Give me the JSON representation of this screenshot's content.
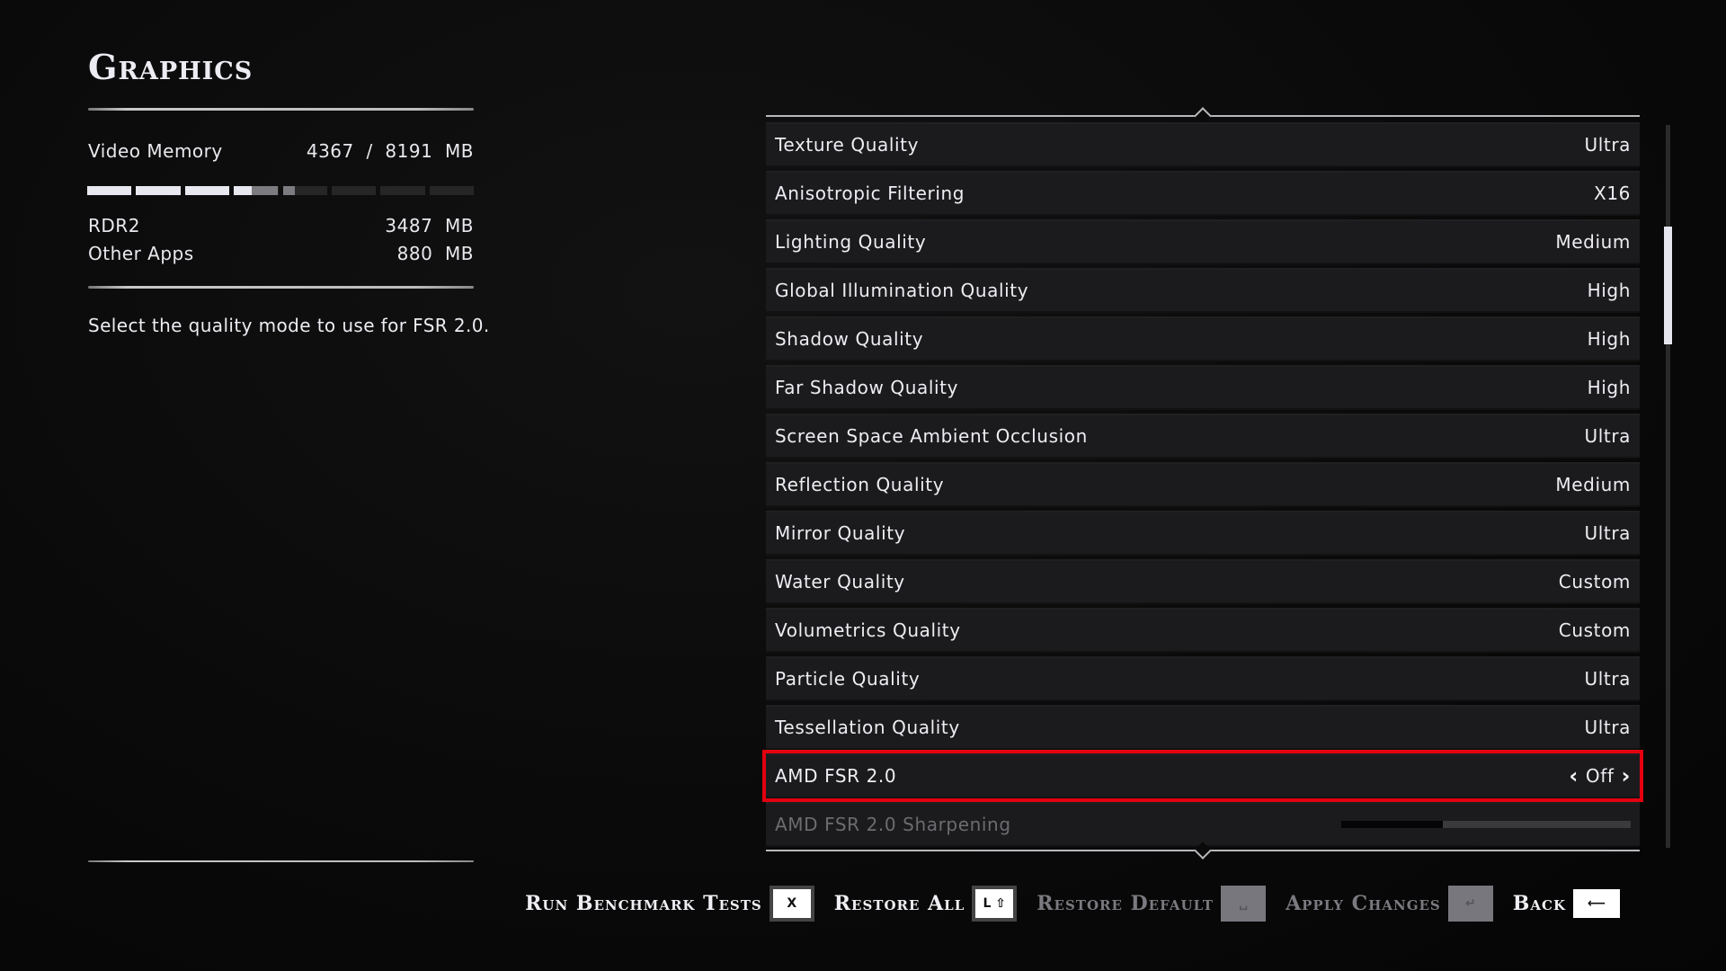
{
  "page": {
    "title": "Graphics"
  },
  "memory": {
    "label": "Video Memory",
    "used": "4367",
    "separator": "/",
    "total": "8191",
    "unit": "MB",
    "used_readout": "4367  /  8191  MB",
    "segments": 8,
    "app_fraction": 0.4257,
    "total_fraction": 0.5331,
    "breakdown": [
      {
        "label": "RDR2",
        "value": "3487  MB"
      },
      {
        "label": "Other Apps",
        "value": "880  MB"
      }
    ]
  },
  "description": "Select the quality mode to use for FSR 2.0.",
  "settings": [
    {
      "label": "Texture Quality",
      "value": "Ultra"
    },
    {
      "label": "Anisotropic Filtering",
      "value": "X16"
    },
    {
      "label": "Lighting Quality",
      "value": "Medium"
    },
    {
      "label": "Global Illumination Quality",
      "value": "High"
    },
    {
      "label": "Shadow Quality",
      "value": "High"
    },
    {
      "label": "Far Shadow Quality",
      "value": "High"
    },
    {
      "label": "Screen Space Ambient Occlusion",
      "value": "Ultra"
    },
    {
      "label": "Reflection Quality",
      "value": "Medium"
    },
    {
      "label": "Mirror Quality",
      "value": "Ultra"
    },
    {
      "label": "Water Quality",
      "value": "Custom"
    },
    {
      "label": "Volumetrics Quality",
      "value": "Custom"
    },
    {
      "label": "Particle Quality",
      "value": "Ultra"
    },
    {
      "label": "Tessellation Quality",
      "value": "Ultra"
    },
    {
      "label": "AMD FSR 2.0",
      "value": "Off",
      "selected": true,
      "type": "stepper"
    },
    {
      "label": "AMD FSR 2.0 Sharpening",
      "type": "slider",
      "disabled": true,
      "slider_fraction": 0.35
    }
  ],
  "scroll": {
    "position_fraction": 0.14,
    "visible_fraction": 0.16
  },
  "highlight_color": "#e3000f",
  "actions": [
    {
      "label": "Run Benchmark Tests",
      "key": "X",
      "enabled": true
    },
    {
      "label": "Restore All",
      "key": "L ⇧",
      "enabled": true
    },
    {
      "label": "Restore Default",
      "key": "␣",
      "enabled": false
    },
    {
      "label": "Apply Changes",
      "key": "↵",
      "enabled": false
    },
    {
      "label": "Back",
      "key": "⟵",
      "enabled": true
    }
  ]
}
